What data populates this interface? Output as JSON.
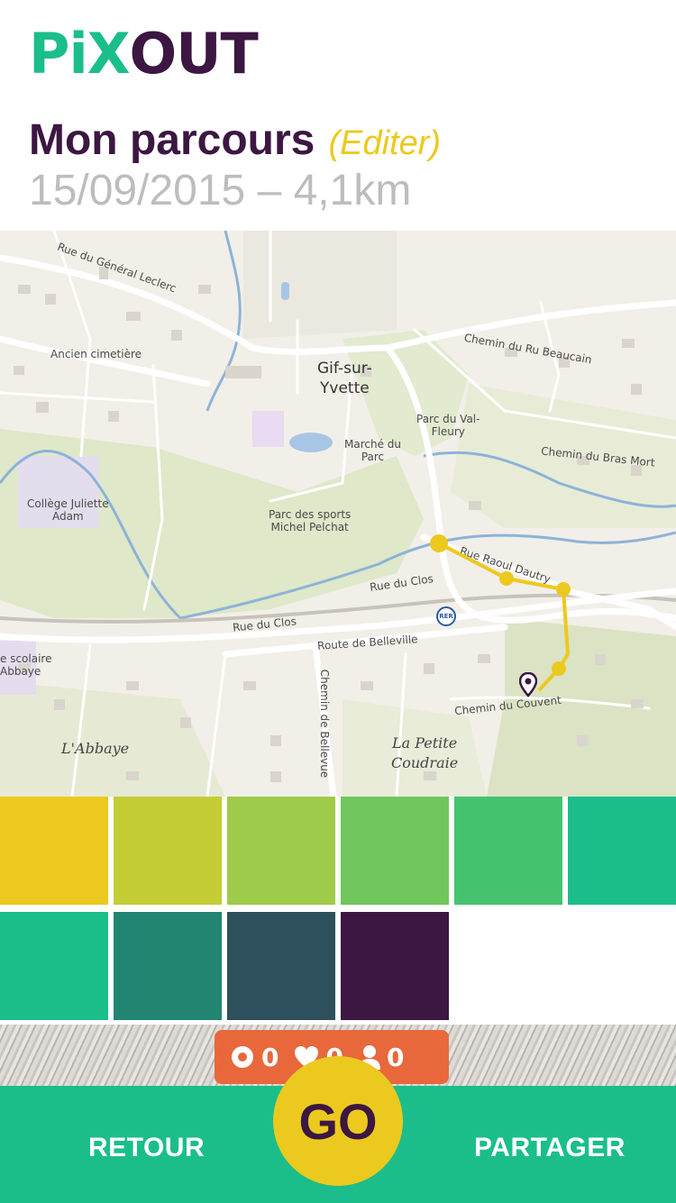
{
  "app": {
    "logo_part1": "PiX",
    "logo_part2": "OUT"
  },
  "header": {
    "title": "Mon parcours",
    "edit_label": "(Editer)",
    "subtitle": "15/09/2015 – 4,1km"
  },
  "map": {
    "labels": {
      "rue_general_leclerc": "Rue du Général Leclerc",
      "ancien_cimetiere": "Ancien cimetière",
      "gif": "Gif-sur-\nYvette",
      "ru_beaucain": "Chemin du Ru Beaucain",
      "parc_val_fleury": "Parc du Val-\nFleury",
      "marche_parc": "Marché du\nParc",
      "bras_mort": "Chemin du Bras Mort",
      "college": "Collège Juliette\nAdam",
      "parc_sports": "Parc des sports\nMichel Pelchat",
      "rue_raoul_dautry": "Rue Raoul Dautry",
      "rue_du_clos_1": "Rue du Clos",
      "rue_du_clos_2": "Rue du Clos",
      "route_belleville": "Route de Belleville",
      "scolaire": "e scolaire\nAbbaye",
      "chemin_bellevue": "Chemin de Bellevue",
      "chemin_couvent": "Chemin du Couvent",
      "abbaye": "L'Abbaye",
      "petite_coudraie": "La Petite\nCoudraie",
      "rer": "RER"
    },
    "route_color": "#ecc91e",
    "marker_color": "#3b1741"
  },
  "swatches": [
    {
      "color": "#ecc91e"
    },
    {
      "color": "#c4cc36"
    },
    {
      "color": "#9fcb4a"
    },
    {
      "color": "#70c75c"
    },
    {
      "color": "#45c270"
    },
    {
      "color": "#1bbe8a"
    },
    {
      "color": "#1bbe8a"
    },
    {
      "color": "#218571"
    },
    {
      "color": "#2e4f5c"
    },
    {
      "color": "#3b1741"
    }
  ],
  "stats": {
    "views": "0",
    "likes": "0",
    "followers": "0",
    "badge_color": "#e8683c"
  },
  "bottom_bar": {
    "back_label": "RETOUR",
    "go_label": "GO",
    "share_label": "PARTAGER"
  },
  "colors": {
    "brand_green": "#1bbe8a",
    "brand_purple": "#3b1741",
    "brand_yellow": "#ecc91e"
  }
}
